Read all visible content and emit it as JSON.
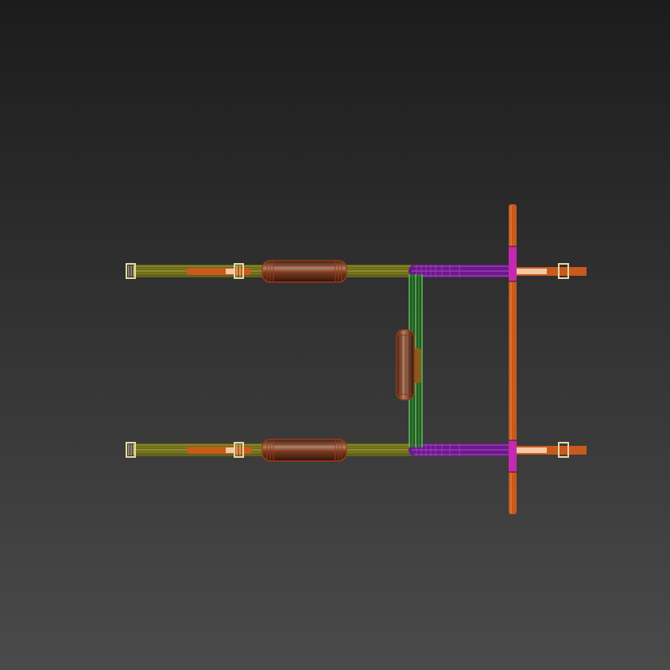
{
  "viewport": {
    "view": "top-view-wireframe",
    "colors": {
      "background_top": "#1c1c1d",
      "background_bottom": "#4a4a4b",
      "rail_olive": "#8a8a1e",
      "rail_olive_dark": "#5d5d12",
      "clamp_cream": "#e9d9a6",
      "clamp_outline": "#bfae72",
      "orange_bar": "#c85a1c",
      "orange_bar_light": "#e08a4c",
      "grip_brown": "#5a2616",
      "grip_highlight": "#b28062",
      "grip_outline": "#a03a16",
      "purple_elbow": "#7a1f9a",
      "purple_line": "#b04ad0",
      "green_crossbar": "#2f9a2f",
      "green_line": "#6ad66a",
      "magenta_joint": "#c42ab0",
      "peach_insert": "#f2c8a6"
    },
    "icons": {
      "clamp": "square-bracket-clamp-icon",
      "grip": "rounded-grip-icon",
      "axle": "vertical-axle-icon"
    }
  }
}
